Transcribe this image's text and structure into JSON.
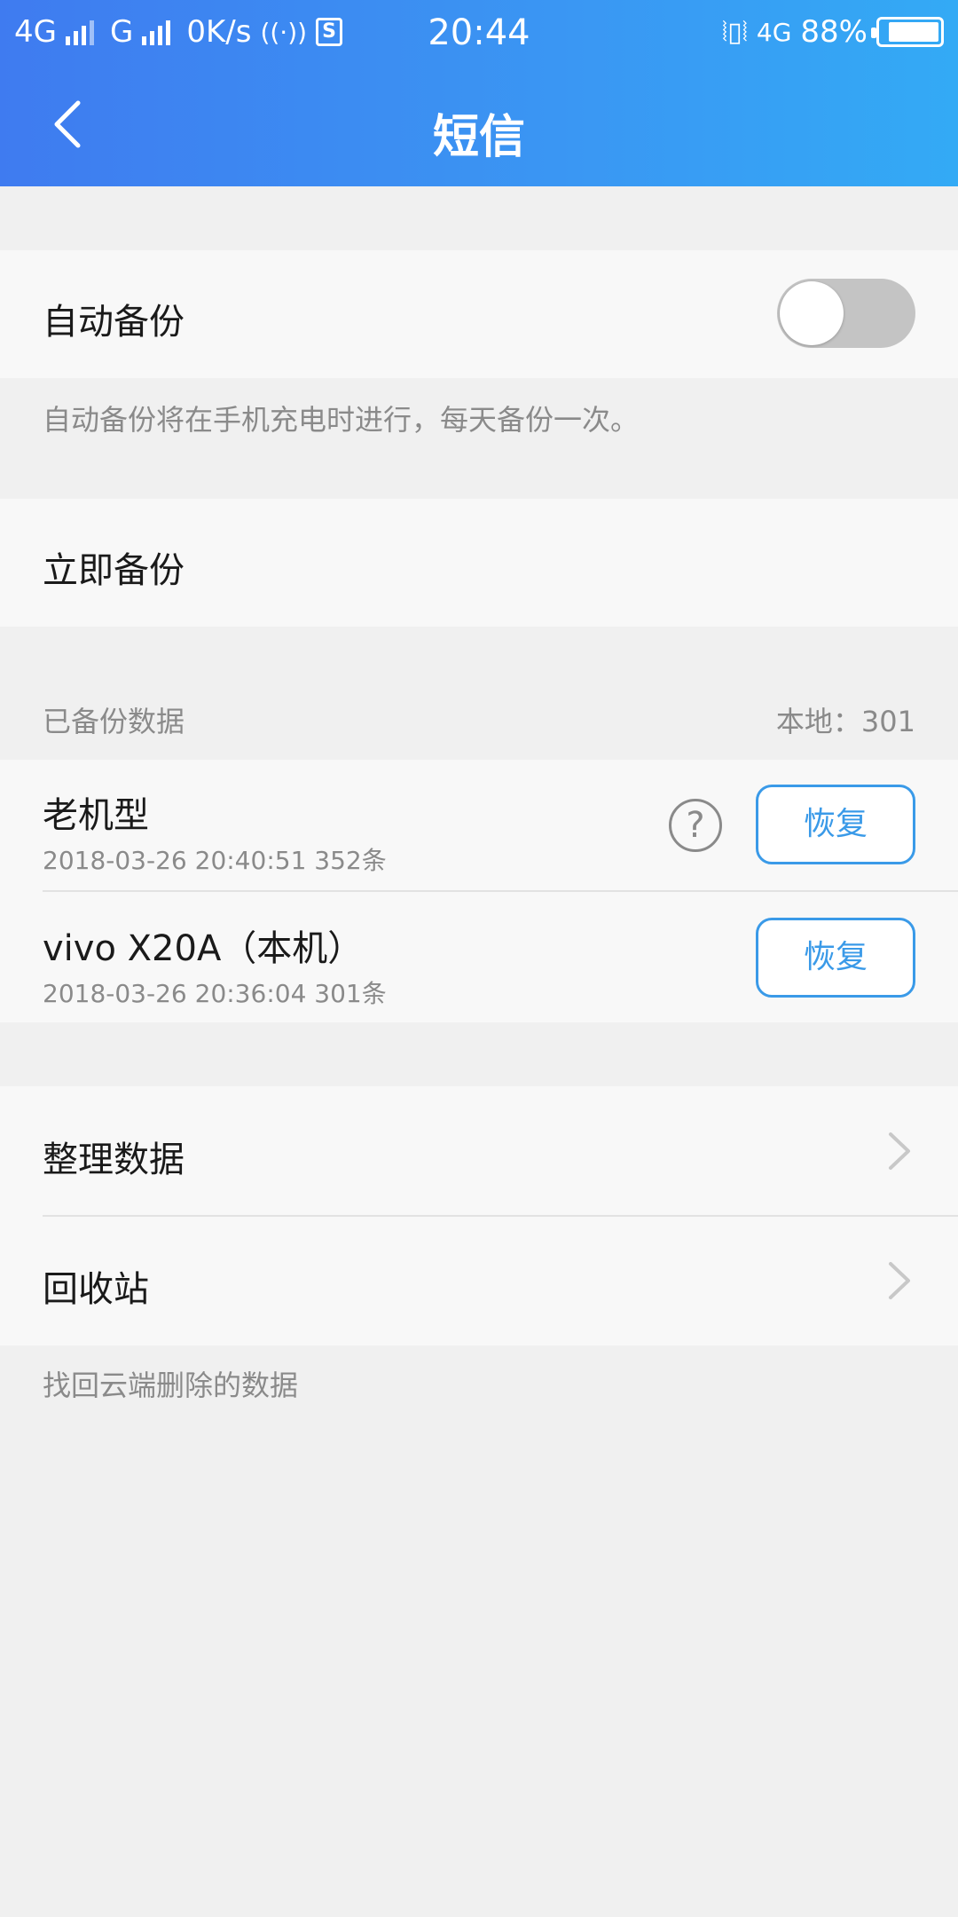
{
  "status_bar": {
    "network1": "4G",
    "network2": "G",
    "speed": "0K/s",
    "sim_icon": "sim-s-icon",
    "time": "20:44",
    "network3": "4G",
    "battery_percent": "88%",
    "battery_level": 0.88
  },
  "header": {
    "title": "短信",
    "back_icon": "back-arrow-icon"
  },
  "auto_backup": {
    "label": "自动备份",
    "enabled": false,
    "note": "自动备份将在手机充电时进行，每天备份一次。"
  },
  "backup_now": {
    "label": "立即备份"
  },
  "backed_up": {
    "section_label": "已备份数据",
    "local_count": "本地：301",
    "items": [
      {
        "name": "老机型",
        "meta": "2018-03-26 20:40:51 352条",
        "has_help": true,
        "restore_label": "恢复"
      },
      {
        "name": "vivo X20A（本机）",
        "meta": "2018-03-26 20:36:04 301条",
        "has_help": false,
        "restore_label": "恢复"
      }
    ]
  },
  "menu": {
    "organize": "整理数据",
    "recycle": "回收站",
    "recycle_note": "找回云端删除的数据"
  },
  "colors": {
    "header_start": "#3f7bf0",
    "header_end": "#33aaf5",
    "accent": "#3a9ae8",
    "background": "#f0f0f0"
  }
}
